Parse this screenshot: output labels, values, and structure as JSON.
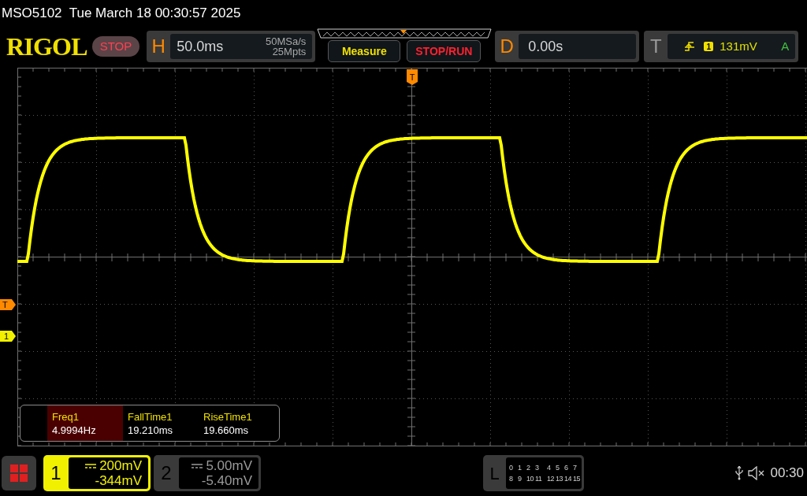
{
  "title": "MSO5102  Tue March 18 00:30:57 2025",
  "logo": "RIGOL",
  "run_state": "STOP",
  "horizontal": {
    "label": "H",
    "timebase": "50.0ms",
    "sample_rate": "50MSa/s",
    "memory_depth": "25Mpts"
  },
  "buttons": [
    {
      "label": "Measure",
      "kind": "measure"
    },
    {
      "label": "STOP/RUN",
      "kind": "stoprun"
    }
  ],
  "delay": {
    "label": "D",
    "value": "0.00s"
  },
  "trigger": {
    "label": "T",
    "source": "1",
    "level": "131mV",
    "mode": "A"
  },
  "markers": {
    "trigger_position": "T",
    "trigger_level": "T",
    "channel": "1"
  },
  "measurements": [
    {
      "name": "Freq1",
      "value": "4.9994Hz",
      "selected": true
    },
    {
      "name": "FallTime1",
      "value": "19.210ms",
      "selected": false
    },
    {
      "name": "RiseTime1",
      "value": "19.660ms",
      "selected": false
    }
  ],
  "channels": [
    {
      "number": "1",
      "scale": "200mV",
      "offset": "-344mV",
      "active": true
    },
    {
      "number": "2",
      "scale": "5.00mV",
      "offset": "-5.40mV",
      "active": false
    }
  ],
  "logic": {
    "label": "L",
    "rows": [
      [
        "0",
        "1",
        "2",
        "3",
        "4",
        "5",
        "6",
        "7"
      ],
      [
        "8",
        "9",
        "10",
        "11",
        "12",
        "13",
        "14",
        "15"
      ]
    ]
  },
  "status": {
    "time": "00:30",
    "muted": true
  }
}
